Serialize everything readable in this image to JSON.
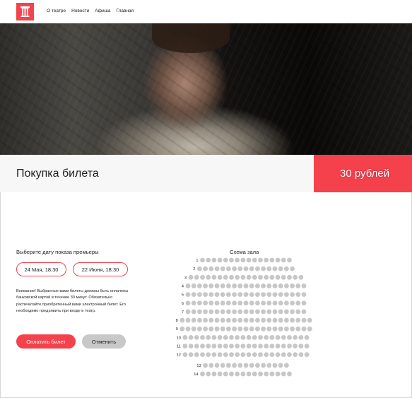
{
  "header": {
    "logo_name": "theatre-column-icon",
    "nav": [
      "О театре",
      "Новости",
      "Афиша",
      "Главная"
    ]
  },
  "hero": {
    "image": "performer-portrait-photo"
  },
  "purchase": {
    "title": "Покупка билета",
    "price": "30 рублей"
  },
  "dates": {
    "label": "Выберите дату показа премьеры",
    "options": [
      "24 Мая, 18:30",
      "22 Июня, 18:30"
    ]
  },
  "notice": "Внимание! Выбранные вами билеты должны быть оплачены банковской картой в течение 30 минут. Обязательно распечатайте приобретенный вами электронный билет. Его необходимо предъявить при входе в театр.",
  "actions": {
    "pay": "Оплатить билет",
    "cancel": "Отменить"
  },
  "hall": {
    "title": "Схема зала",
    "rows": [
      {
        "label": "1",
        "seats": 16
      },
      {
        "label": "2",
        "seats": 17
      },
      {
        "label": "3",
        "seats": 20
      },
      {
        "label": "4",
        "seats": 21
      },
      {
        "label": "5",
        "seats": 21
      },
      {
        "label": "6",
        "seats": 21
      },
      {
        "label": "7",
        "seats": 21
      },
      {
        "label": "8",
        "seats": 23
      },
      {
        "label": "9",
        "seats": 23
      },
      {
        "label": "10",
        "seats": 22
      },
      {
        "label": "11",
        "seats": 22
      },
      {
        "label": "12",
        "seats": 22
      },
      {
        "label": "13",
        "seats": 15
      },
      {
        "label": "14",
        "seats": 16
      }
    ]
  },
  "colors": {
    "accent": "#f4414c",
    "seat": "#c7c7c7",
    "cancel_bg": "#c8c8c8"
  }
}
